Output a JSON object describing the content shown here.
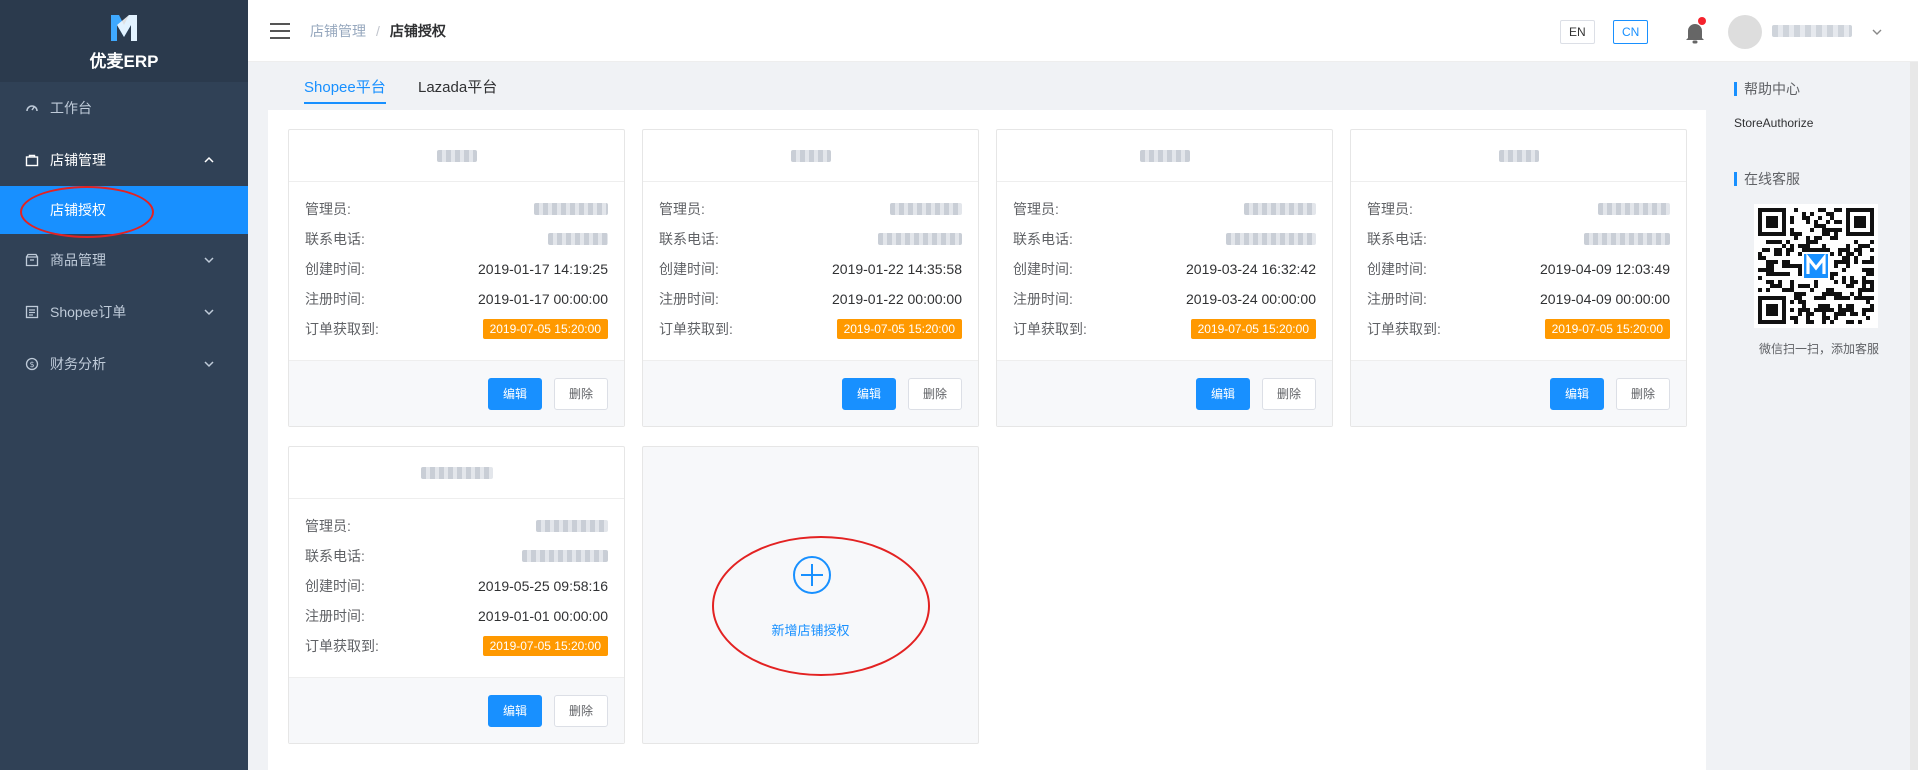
{
  "app": {
    "name": "优麦ERP"
  },
  "sidebar": {
    "items": [
      {
        "label": "工作台",
        "icon": "dashboard-icon"
      },
      {
        "label": "店铺管理",
        "icon": "shop-icon",
        "open": true
      },
      {
        "label": "店铺授权",
        "active": true
      },
      {
        "label": "商品管理",
        "icon": "goods-icon"
      },
      {
        "label": "Shopee订单",
        "icon": "order-icon"
      },
      {
        "label": "财务分析",
        "icon": "finance-icon"
      }
    ]
  },
  "header": {
    "breadcrumb": [
      "店铺管理",
      "店铺授权"
    ],
    "lang_en": "EN",
    "lang_cn": "CN"
  },
  "tabs": [
    "Shopee平台",
    "Lazada平台"
  ],
  "field_labels": {
    "admin": "管理员:",
    "phone": "联系电话:",
    "created": "创建时间:",
    "registered": "注册时间:",
    "orders_until": "订单获取到:"
  },
  "buttons": {
    "edit": "编辑",
    "delete": "删除"
  },
  "stores": [
    {
      "created": "2019-01-17 14:19:25",
      "registered": "2019-01-17 00:00:00",
      "orders_until": "2019-07-05 15:20:00"
    },
    {
      "created": "2019-01-22 14:35:58",
      "registered": "2019-01-22 00:00:00",
      "orders_until": "2019-07-05 15:20:00"
    },
    {
      "created": "2019-03-24 16:32:42",
      "registered": "2019-03-24 00:00:00",
      "orders_until": "2019-07-05 15:20:00"
    },
    {
      "created": "2019-04-09 12:03:49",
      "registered": "2019-04-09 00:00:00",
      "orders_until": "2019-07-05 15:20:00"
    },
    {
      "created": "2019-05-25 09:58:16",
      "registered": "2019-01-01 00:00:00",
      "orders_until": "2019-07-05 15:20:00"
    }
  ],
  "add_store": {
    "label": "新增店铺授权",
    "icon": "plus-circle-icon"
  },
  "right_panel": {
    "help_title": "帮助中心",
    "help_link": "StoreAuthorize",
    "service_title": "在线客服",
    "qr_caption": "微信扫一扫，添加客服"
  },
  "colors": {
    "primary": "#1890ff",
    "sidebar_bg": "#304156",
    "tag_orange": "#ff9900",
    "annotation_red": "#e32222"
  }
}
